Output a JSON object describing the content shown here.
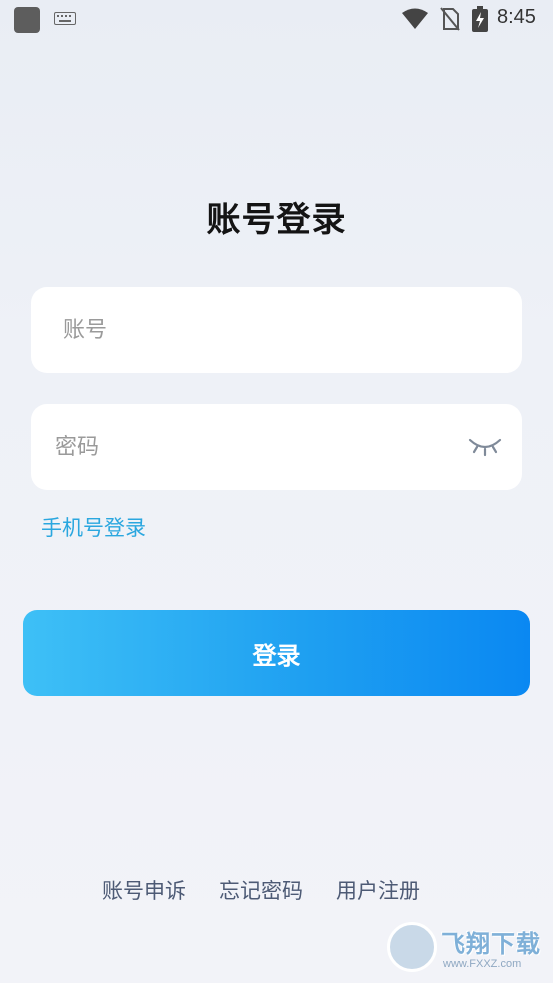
{
  "status_bar": {
    "time": "8:45",
    "icons": [
      "app-square-icon",
      "keyboard-icon",
      "wifi-icon",
      "no-sim-icon",
      "battery-charging-icon"
    ]
  },
  "title": "账号登录",
  "account": {
    "placeholder": "账号",
    "value": ""
  },
  "password": {
    "placeholder": "密码",
    "value": "",
    "toggle_icon": "eye-closed-icon"
  },
  "phone_login_link": "手机号登录",
  "login_button": "登录",
  "footer": {
    "appeal": "账号申诉",
    "forgot": "忘记密码",
    "register": "用户注册"
  },
  "watermark": {
    "text": "飞翔下载",
    "url": "www.FXXZ.com"
  },
  "colors": {
    "accent": "#2aa7df",
    "button_start": "#3ec0f6",
    "button_end": "#0a88f2",
    "footer_text": "#4d5a75"
  }
}
